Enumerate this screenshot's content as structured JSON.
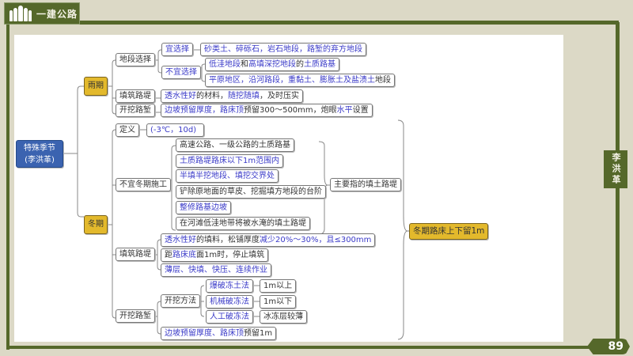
{
  "header": {
    "title": "一建公路"
  },
  "side_tab": {
    "label": "李洪革"
  },
  "page_number": "89",
  "colors": {
    "olive": "#55682a",
    "background": "#dcd9c6",
    "highlight": "#e3b92c",
    "blue_text": "#3a3ac8",
    "root": "#3b63b0"
  },
  "mindmap": {
    "root": "特殊季节\n(李洪革)",
    "rain": {
      "label": "雨期",
      "site": "地段选择",
      "suitable": "宜选择",
      "suitable_detail": [
        [
          "砂类土、碎砾石，岩石地段，",
          1
        ],
        [
          "路堑的弃方地段",
          1
        ]
      ],
      "unsuitable": "不宜选择",
      "unsuitable_1": [
        [
          "低洼地段",
          1
        ],
        [
          "和",
          0
        ],
        [
          "高填深挖地段",
          1
        ],
        [
          "的",
          0
        ],
        [
          "土质路基",
          1
        ]
      ],
      "unsuitable_2": [
        [
          "平原地区，沿河路段，重黏土、膨胀土及盐渍土",
          1
        ],
        [
          "地段",
          0
        ]
      ],
      "fill": "填筑路堤",
      "fill_detail": [
        [
          "透水性好",
          1
        ],
        [
          "的材料，",
          0
        ],
        [
          "随挖随填",
          1
        ],
        [
          "，及时压实",
          0
        ]
      ],
      "cut": "开挖路堑",
      "cut_detail": [
        [
          "边坡预留厚度，路床顶",
          1
        ],
        [
          "预留300～500mm，炮眼",
          0
        ],
        [
          "水平",
          1
        ],
        [
          "设置",
          0
        ]
      ]
    },
    "winter": {
      "label": "冬期",
      "definition": "定义",
      "definition_value": [
        [
          "(-3℃，10d)",
          1
        ]
      ],
      "unsuitable": "不宜冬期施工",
      "unsuitable_items": [
        [
          [
            "高速公路、一级公路的土质路基",
            0
          ]
        ],
        [
          [
            "土质路堤路床以下1m范围内",
            1
          ]
        ],
        [
          [
            "半填半挖地段、填挖交界处",
            1
          ]
        ],
        [
          [
            "铲除原地面的草皮、挖掘填方地段的台阶",
            0
          ]
        ],
        [
          [
            "整修路基边坡",
            1
          ]
        ],
        [
          [
            "在河滩低洼地带将被水淹的填土路堤",
            0
          ]
        ]
      ],
      "unsuitable_note": "主要指的填土路堤",
      "summary": "冬期路床上下留1m",
      "fill": "填筑路堤",
      "fill_items": [
        [
          [
            "透水性好",
            1
          ],
          [
            "的填料，松铺厚度",
            0
          ],
          [
            "减少20%～30%，且≤300mm",
            1
          ]
        ],
        [
          [
            "距",
            0
          ],
          [
            "路床底",
            1
          ],
          [
            "面1m时，停止填筑",
            0
          ]
        ],
        [
          [
            "薄层、快填、快压、连续作业",
            1
          ]
        ]
      ],
      "cut": "开挖路堑",
      "cut_method": "开挖方法",
      "methods": [
        {
          "name": "爆破冻土法",
          "note": "1m以上"
        },
        {
          "name": "机械破冻法",
          "note": "1m以下"
        },
        {
          "name": "人工破冻法",
          "note": "冰冻层较薄"
        }
      ],
      "cut_detail": [
        [
          "边坡预留厚度、路床顶",
          1
        ],
        [
          "预留1m",
          0
        ]
      ]
    }
  }
}
